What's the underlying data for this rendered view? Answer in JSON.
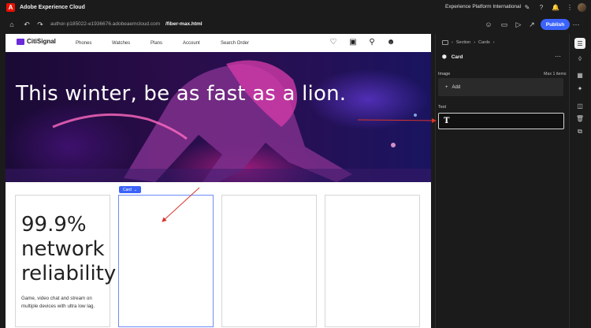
{
  "topbar": {
    "app_title": "Adobe Experience Cloud",
    "org": "Experience Platform International",
    "logo": "A"
  },
  "toolbar": {
    "url": "author-p185022-e1936676.adobeaemcloud.com",
    "file": "/fiber-max.html",
    "publish": "Publish"
  },
  "site": {
    "brand": "CitiSignal",
    "nav": [
      "Phones",
      "Watches",
      "Plans",
      "Account",
      "Search Order"
    ],
    "hero_title": "This winter, be as fast as a lion."
  },
  "cards": {
    "selected_label": "Card",
    "first_big": "99.9% network reliability",
    "first_desc": "Game, video chat and stream on multiple devices with ultra low lag."
  },
  "panel": {
    "crumb_section": "Section",
    "crumb_cards": "Cards",
    "title": "Card",
    "image_label": "Image",
    "max_items": "Max 1 items",
    "add_label": "Add",
    "text_label": "Text",
    "text_icon": "T"
  },
  "colors": {
    "accent": "#3b63fb",
    "arrow": "#d9342b",
    "adobe_red": "#eb1000"
  }
}
